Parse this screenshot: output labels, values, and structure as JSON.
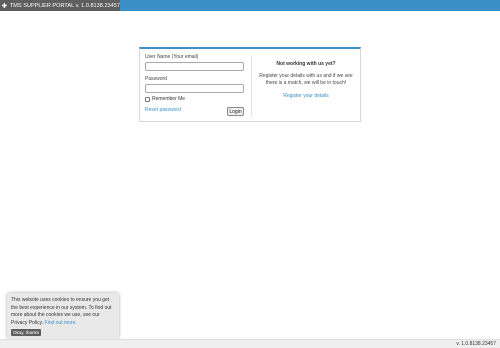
{
  "header": {
    "title": "TMS SUPPLIER PORTAL v. 1.0.8138.23457",
    "logo_icon": "plus-cross-icon",
    "bar_color": "#3a8fc8",
    "brand_bg": "#5e5e5e"
  },
  "login": {
    "username_label": "User Name (Your email)",
    "username_value": "",
    "password_label": "Password",
    "password_value": "",
    "remember_label": "Remember Me",
    "remember_checked": false,
    "reset_link": "Reset password",
    "login_button": "Login"
  },
  "signup": {
    "title": "Not working with us yet?",
    "text": "Register your details with us and if we see there is a match, we will be in touch!",
    "link": "Register your details"
  },
  "cookie": {
    "text": "This website uses cookies to ensure you get the best experience in our system. To find out more about the cookies we use, see our Privacy Policy.",
    "link": "Find out more.",
    "button": "Okay, thanks"
  },
  "footer": {
    "version": "v. 1.0.8138.23457"
  }
}
